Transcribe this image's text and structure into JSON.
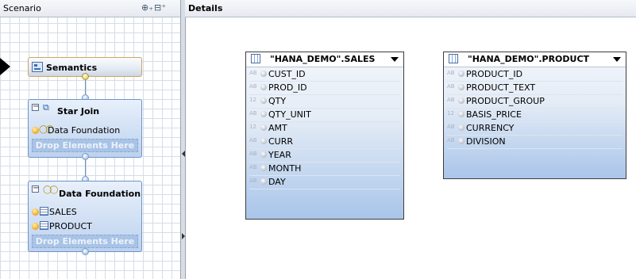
{
  "scenario": {
    "title": "Scenario",
    "header_buttons": [
      "⊕₊",
      "⊟⁺"
    ],
    "semantics": {
      "label": "Semantics"
    },
    "star_join": {
      "title": "Star Join",
      "items": [
        "Data Foundation"
      ],
      "drop_label": "Drop Elements Here"
    },
    "data_foundation": {
      "title": "Data Foundation",
      "items": [
        "SALES",
        "PRODUCT"
      ],
      "drop_label": "Drop Elements Here"
    }
  },
  "details": {
    "title": "Details",
    "tables": [
      {
        "name": "\"HANA_DEMO\".SALES",
        "columns": [
          {
            "type": "AB",
            "name": "CUST_ID"
          },
          {
            "type": "AB",
            "name": "PROD_ID"
          },
          {
            "type": "12",
            "name": "QTY"
          },
          {
            "type": "AB",
            "name": "QTY_UNIT"
          },
          {
            "type": "12",
            "name": "AMT"
          },
          {
            "type": "AB",
            "name": "CURR"
          },
          {
            "type": "AB",
            "name": "YEAR"
          },
          {
            "type": "AB",
            "name": "MONTH"
          },
          {
            "type": "AB",
            "name": "DAY"
          }
        ]
      },
      {
        "name": "\"HANA_DEMO\".PRODUCT",
        "columns": [
          {
            "type": "AB",
            "name": "PRODUCT_ID"
          },
          {
            "type": "AB",
            "name": "PRODUCT_TEXT"
          },
          {
            "type": "AB",
            "name": "PRODUCT_GROUP"
          },
          {
            "type": "12",
            "name": "BASIS_PRICE"
          },
          {
            "type": "AB",
            "name": "CURRENCY"
          },
          {
            "type": "AB",
            "name": "DIVISION"
          }
        ]
      }
    ]
  }
}
